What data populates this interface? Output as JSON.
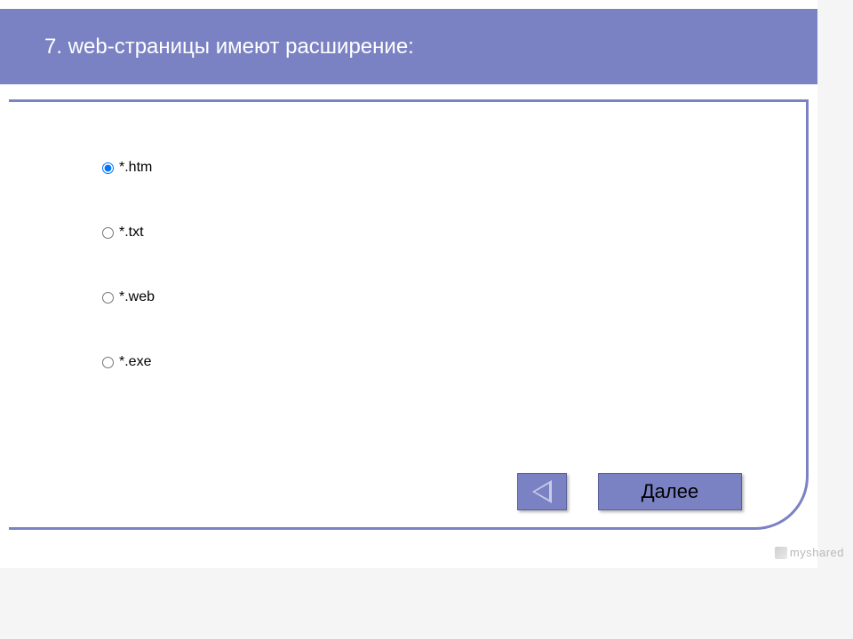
{
  "question": {
    "number": "7",
    "title": "7. web-страницы имеют расширение:"
  },
  "options": [
    {
      "label": "*.htm",
      "selected": true
    },
    {
      "label": "*.txt",
      "selected": false
    },
    {
      "label": "*.web",
      "selected": false
    },
    {
      "label": "*.exe",
      "selected": false
    }
  ],
  "navigation": {
    "next_label": "Далее"
  },
  "watermark": {
    "text": "myshared"
  }
}
